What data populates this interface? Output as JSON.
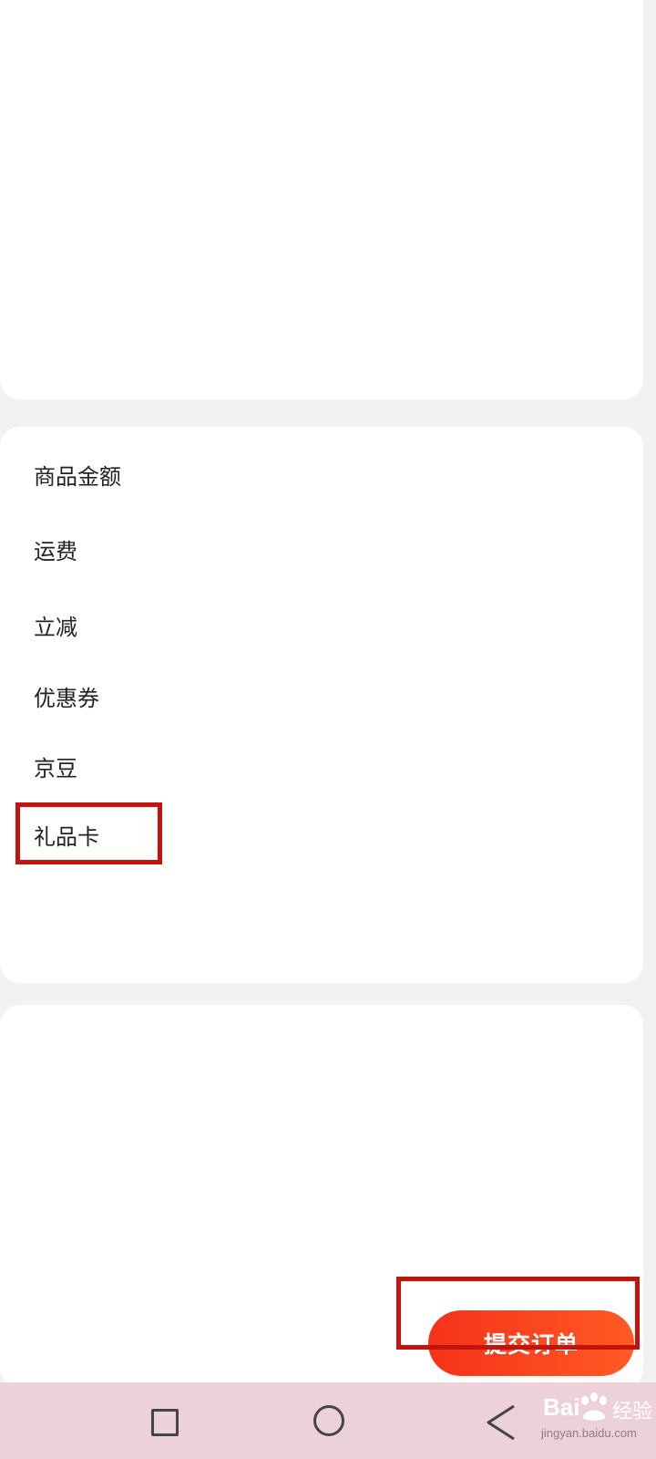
{
  "summary": {
    "rows": [
      {
        "label": "商品金额"
      },
      {
        "label": "运费"
      },
      {
        "label": "立减"
      },
      {
        "label": "优惠券"
      },
      {
        "label": "京豆"
      },
      {
        "label": "礼品卡"
      }
    ]
  },
  "action": {
    "submit_label": "提交订单",
    "accent_color": "#f5321a"
  },
  "annotation": {
    "highlight_color": "#c4120d"
  },
  "nav": {
    "icons": [
      "recents-square-icon",
      "home-circle-icon",
      "back-triangle-icon"
    ],
    "background": "#ecd2d8"
  },
  "watermark": {
    "brand": "Bai",
    "suffix": "经验",
    "url": "jingyan.baidu.com"
  }
}
